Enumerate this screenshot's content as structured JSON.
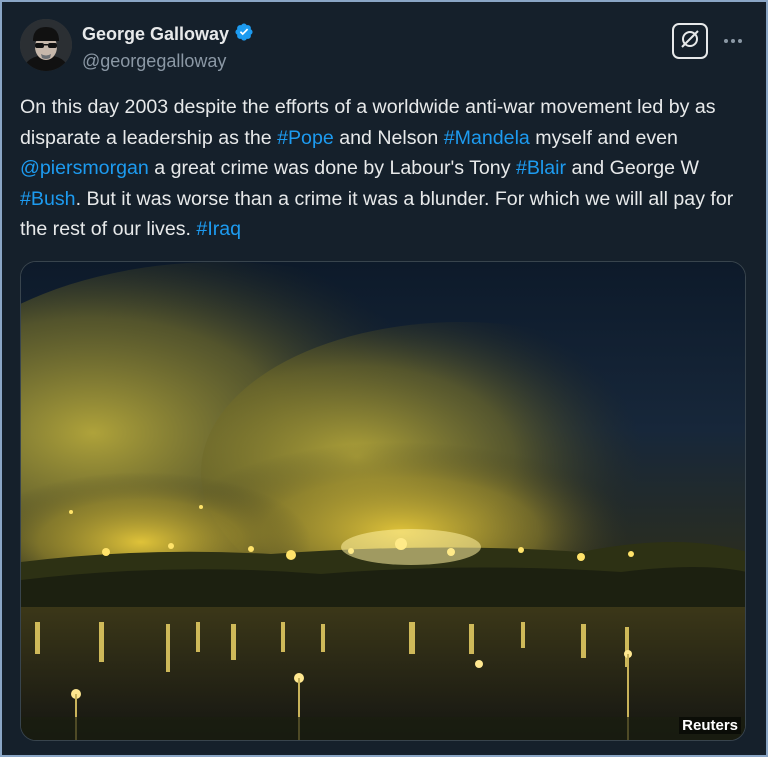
{
  "author": {
    "display_name": "George Galloway",
    "handle": "@georgegalloway",
    "verified_icon": "verified-badge-icon",
    "avatar_icon": "avatar"
  },
  "actions": {
    "grok_icon": "grok-icon",
    "more_icon": "more-icon"
  },
  "tweet": {
    "segments": [
      {
        "text": "On this day 2003 despite the efforts of a worldwide anti-war movement led by as disparate a leadership as the ",
        "type": "text"
      },
      {
        "text": "#Pope",
        "type": "link"
      },
      {
        "text": " and Nelson ",
        "type": "text"
      },
      {
        "text": "#Mandela",
        "type": "link"
      },
      {
        "text": " myself and even ",
        "type": "text"
      },
      {
        "text": "@piersmorgan",
        "type": "link"
      },
      {
        "text": " a great crime was done by Labour's Tony ",
        "type": "text"
      },
      {
        "text": "#Blair",
        "type": "link"
      },
      {
        "text": " and George W ",
        "type": "text"
      },
      {
        "text": "#Bush",
        "type": "link"
      },
      {
        "text": ". But it was worse than a crime it was a blunder. For which we will all pay for the rest of our lives. ",
        "type": "text"
      },
      {
        "text": "#Iraq",
        "type": "link"
      }
    ]
  },
  "media": {
    "watermark": "Reuters"
  },
  "colors": {
    "background": "#15202b",
    "text": "#e7e9ea",
    "link": "#1d9bf0",
    "secondary": "#8b98a5"
  }
}
